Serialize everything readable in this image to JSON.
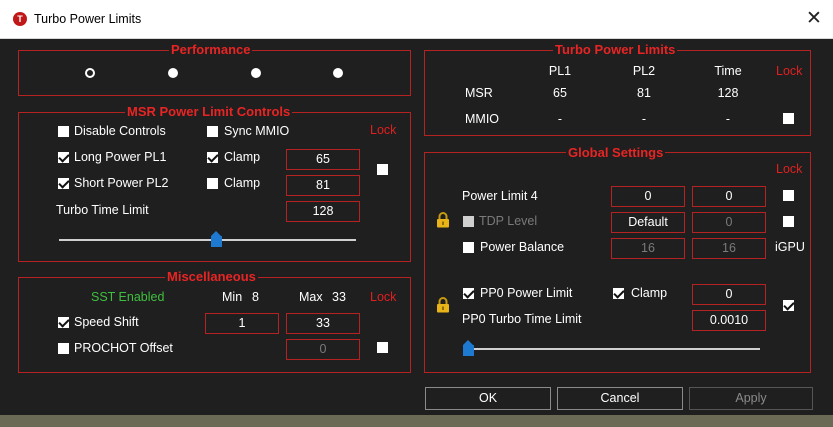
{
  "window": {
    "title": "Turbo Power Limits",
    "icon_letter": "T",
    "close_glyph": "✕"
  },
  "performance": {
    "title": "Performance"
  },
  "msr": {
    "title": "MSR Power Limit Controls",
    "disable_controls": "Disable Controls",
    "sync_mmio": "Sync MMIO",
    "lock": "Lock",
    "long_pl1": "Long Power PL1",
    "short_pl2": "Short Power PL2",
    "clamp": "Clamp",
    "pl1_value": "65",
    "pl2_value": "81",
    "turbo_time_label": "Turbo Time Limit",
    "turbo_time_value": "128"
  },
  "misc": {
    "title": "Miscellaneous",
    "sst": "SST Enabled",
    "min_label": "Min",
    "min_value": "8",
    "max_label": "Max",
    "max_value": "33",
    "lock": "Lock",
    "speed_shift": "Speed Shift",
    "speed_min": "1",
    "speed_max": "33",
    "prochot": "PROCHOT Offset",
    "prochot_value": "0"
  },
  "tpl": {
    "title": "Turbo Power Limits",
    "headers": [
      "PL1",
      "PL2",
      "Time",
      "Lock"
    ],
    "msr_row": [
      "MSR",
      "65",
      "81",
      "128"
    ],
    "mmio_row": [
      "MMIO",
      "-",
      "-",
      "-"
    ]
  },
  "global": {
    "title": "Global Settings",
    "lock": "Lock",
    "pl4_label": "Power Limit 4",
    "pl4_a": "0",
    "pl4_b": "0",
    "tdp_label": "TDP Level",
    "tdp_a": "Default",
    "tdp_b": "0",
    "pb_label": "Power Balance",
    "pb_a": "16",
    "pb_b": "16",
    "igpu": "iGPU",
    "pp0_label": "PP0 Power Limit",
    "pp0_clamp": "Clamp",
    "pp0_value": "0",
    "pp0_time_label": "PP0 Turbo Time Limit",
    "pp0_time_value": "0.0010"
  },
  "buttons": {
    "ok": "OK",
    "cancel": "Cancel",
    "apply": "Apply"
  }
}
